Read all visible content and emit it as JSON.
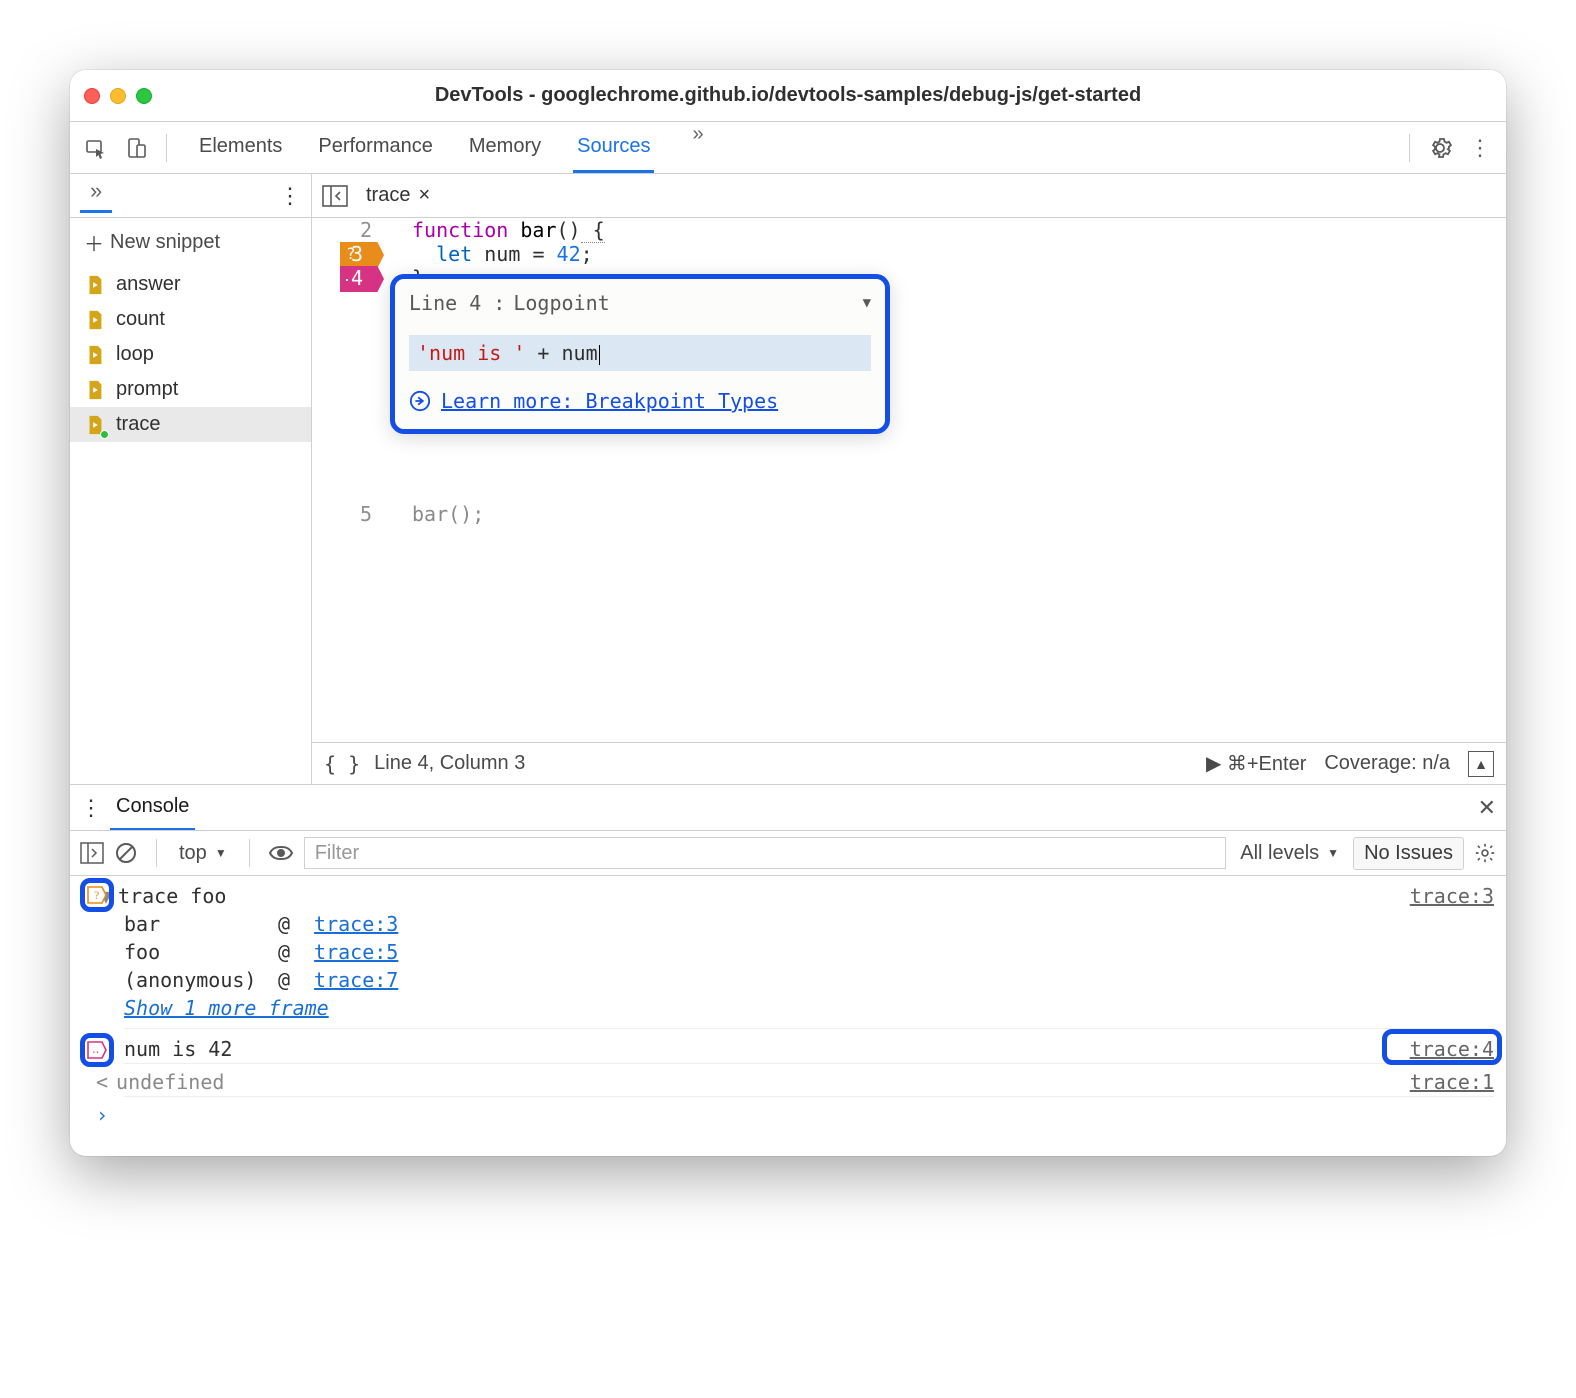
{
  "window": {
    "title": "DevTools - googlechrome.github.io/devtools-samples/debug-js/get-started"
  },
  "tabs": {
    "elements": "Elements",
    "performance": "Performance",
    "memory": "Memory",
    "sources": "Sources",
    "more": "»"
  },
  "sidebar": {
    "more": "»",
    "newSnippet": "New snippet",
    "items": [
      {
        "label": "answer"
      },
      {
        "label": "count"
      },
      {
        "label": "loop"
      },
      {
        "label": "prompt"
      },
      {
        "label": "trace"
      }
    ]
  },
  "editor": {
    "fileTab": "trace",
    "close": "×",
    "lines": {
      "l2": {
        "num": "2",
        "keyword": "function",
        "name": "bar",
        "paren": "()",
        "brace": " {"
      },
      "l3": {
        "num": "3",
        "let": "let",
        "var": " num ",
        "eq": "= ",
        "val": "42",
        "semi": ";"
      },
      "l4": {
        "num": "4",
        "brace": "}"
      },
      "l5": {
        "num": "5",
        "call": "bar();"
      }
    },
    "popover": {
      "lineLabel": "Line 4 :",
      "type": "Logpoint",
      "input": {
        "str": "'num is '",
        "rest": " + num"
      },
      "learn": "Learn more: Breakpoint Types"
    },
    "status": {
      "pretty": "{ }",
      "pos": "Line 4, Column 3",
      "run": "▶ ⌘+Enter",
      "coverage": "Coverage: n/a"
    }
  },
  "console": {
    "tab": "Console",
    "toolbar": {
      "context": "top",
      "filterPlaceholder": "Filter",
      "levels": "All levels",
      "issues": "No Issues"
    },
    "entries": {
      "traceFoo": "trace foo",
      "traceFooSrc": "trace:3",
      "stack": [
        {
          "fn": "bar",
          "at": "@",
          "link": "trace:3"
        },
        {
          "fn": "foo",
          "at": "@",
          "link": "trace:5"
        },
        {
          "fn": "(anonymous)",
          "at": "@",
          "link": "trace:7"
        }
      ],
      "showMore": "Show 1 more frame",
      "logOut": "num is 42",
      "logSrc": "trace:4",
      "undef": "undefined",
      "undefSrc": "trace:1"
    }
  }
}
